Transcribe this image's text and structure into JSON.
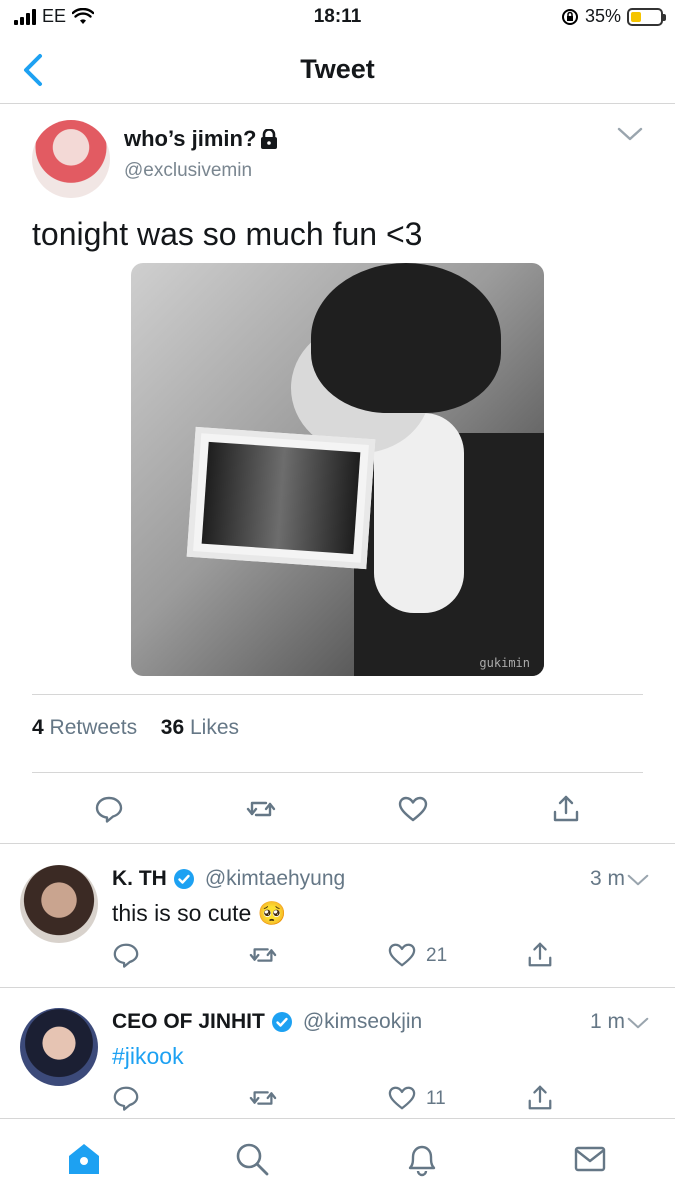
{
  "status_bar": {
    "carrier": "EE",
    "time": "18:11",
    "battery_percent": "35%",
    "battery_level": 0.35,
    "icons": [
      "signal-icon",
      "wifi-icon",
      "rotation-lock-icon",
      "battery-icon"
    ]
  },
  "nav": {
    "title": "Tweet",
    "back_icon": "chevron-left-icon"
  },
  "main_tweet": {
    "display_name": "who’s jimin?",
    "handle": "@exclusivemin",
    "text": "tonight was so much fun <3",
    "media_watermark": "gukimin",
    "retweets_count": "4",
    "retweets_label": "Retweets",
    "likes_count": "36",
    "likes_label": "Likes",
    "icons": [
      "lock-icon",
      "chevron-down-icon",
      "reply-icon",
      "retweet-icon",
      "like-icon",
      "share-icon"
    ]
  },
  "replies": [
    {
      "display_name": "K. TH",
      "handle": "@kimtaehyung",
      "time": "3 m",
      "text": "this is so cute 🥺",
      "likes": "21"
    },
    {
      "display_name": "CEO OF JINHIT",
      "handle": "@kimseokjin",
      "time": "1 m",
      "text": "#jikook",
      "likes": "11"
    }
  ],
  "tab_bar": {
    "tabs": [
      "home-icon",
      "search-icon",
      "notifications-icon",
      "messages-icon"
    ],
    "active": "home-icon"
  },
  "colors": {
    "accent": "#1da1f2",
    "secondary_text": "#657786",
    "divider": "#d6d6d6"
  }
}
